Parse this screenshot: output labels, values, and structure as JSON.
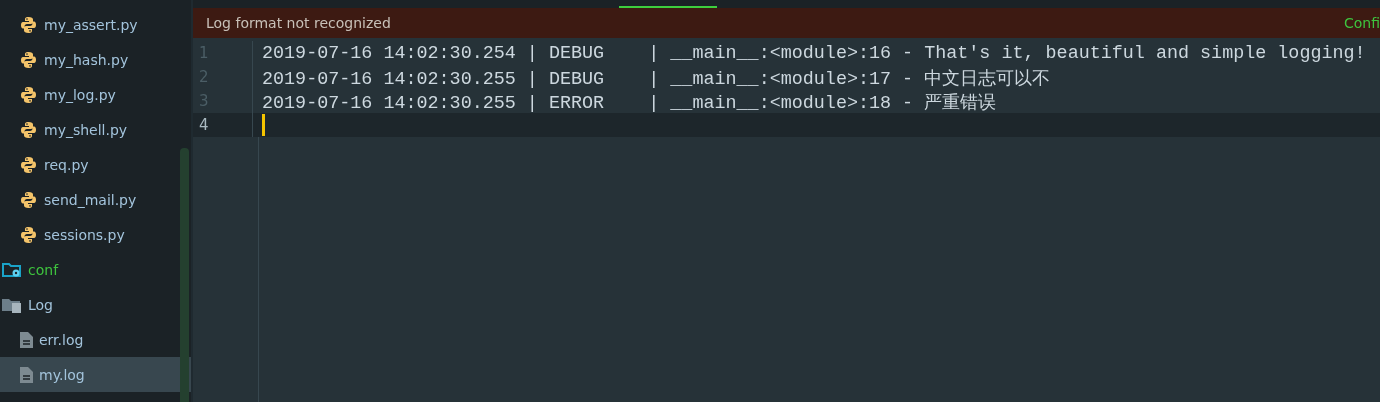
{
  "sidebar": {
    "items": [
      {
        "label": "my_assert.py",
        "kind": "python",
        "selected": false
      },
      {
        "label": "my_hash.py",
        "kind": "python",
        "selected": false
      },
      {
        "label": "my_log.py",
        "kind": "python",
        "selected": false
      },
      {
        "label": "my_shell.py",
        "kind": "python",
        "selected": false
      },
      {
        "label": "req.py",
        "kind": "python",
        "selected": false
      },
      {
        "label": "send_mail.py",
        "kind": "python",
        "selected": false
      },
      {
        "label": "sessions.py",
        "kind": "python",
        "selected": false
      },
      {
        "label": "conf",
        "kind": "config-folder",
        "selected": false
      },
      {
        "label": "Log",
        "kind": "folder",
        "selected": false,
        "children": [
          {
            "label": "err.log",
            "kind": "file",
            "selected": false
          },
          {
            "label": "my.log",
            "kind": "file",
            "selected": true
          }
        ]
      }
    ]
  },
  "banner": {
    "message": "Log format not recognized",
    "action": "Confi"
  },
  "editor": {
    "lines": [
      {
        "number": "1",
        "text": "2019-07-16 14:02:30.254 | DEBUG    | __main__:<module>:16 - That's it, beautiful and simple logging!",
        "current": false
      },
      {
        "number": "2",
        "text": "2019-07-16 14:02:30.255 | DEBUG    | __main__:<module>:17 - 中文日志可以不",
        "current": false
      },
      {
        "number": "3",
        "text": "2019-07-16 14:02:30.255 | ERROR    | __main__:<module>:18 - 严重错误",
        "current": false
      },
      {
        "number": "4",
        "current": true
      }
    ]
  }
}
